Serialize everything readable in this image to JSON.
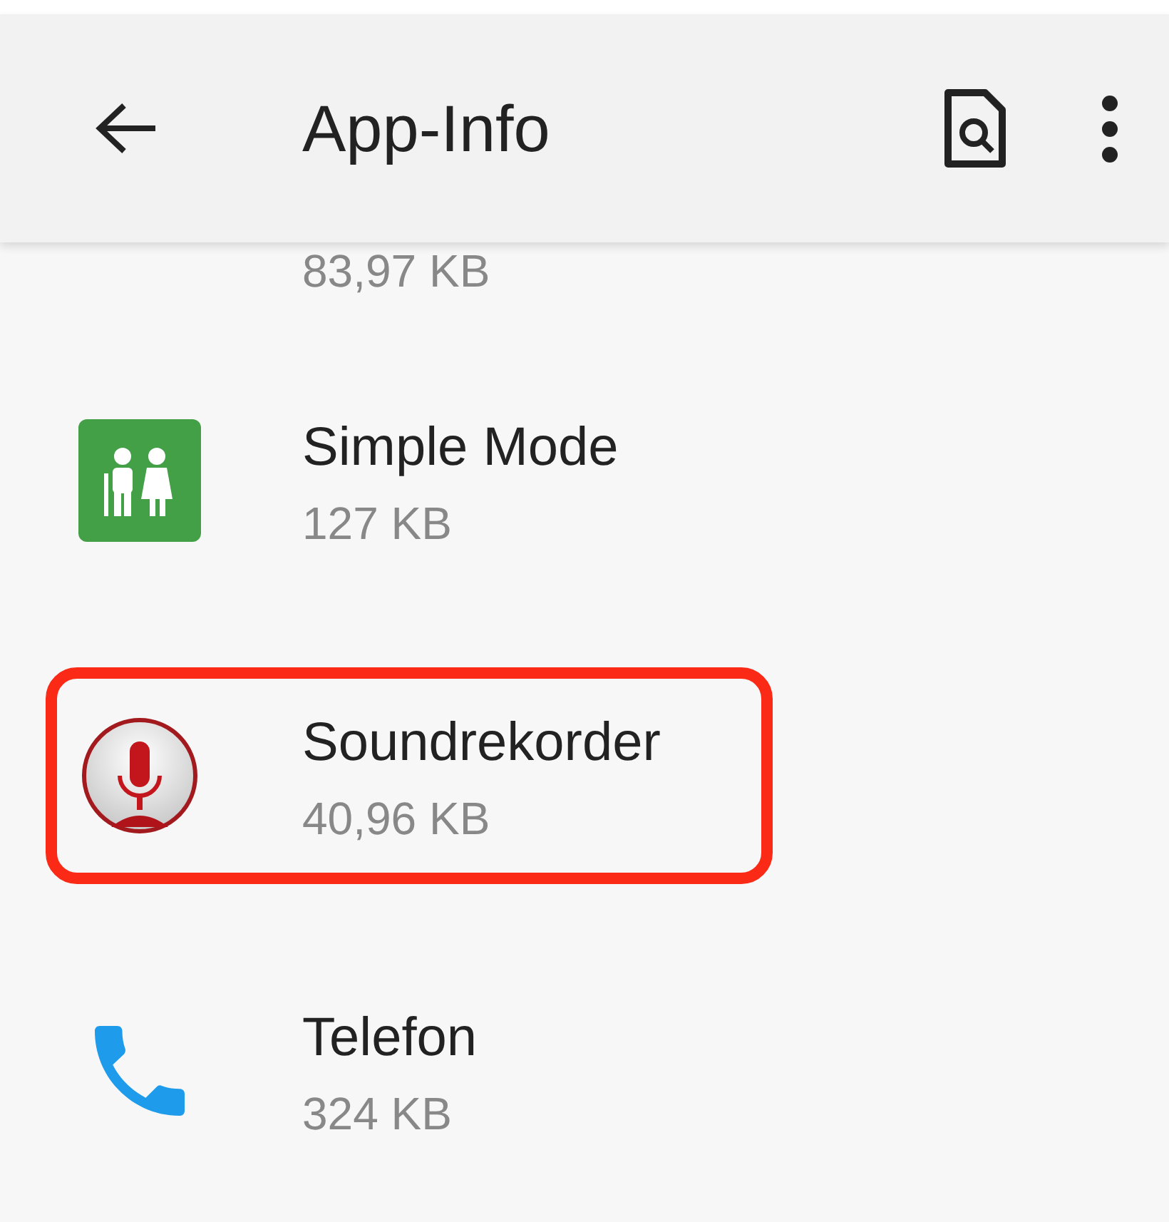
{
  "app_bar": {
    "title": "App-Info"
  },
  "apps": [
    {
      "kind": "partial",
      "size": "83,97 KB",
      "highlighted": false
    },
    {
      "kind": "simple_mode",
      "name": "Simple Mode",
      "size": "127 KB",
      "highlighted": false
    },
    {
      "kind": "recorder",
      "name": "Soundrekorder",
      "size": "40,96 KB",
      "highlighted": true
    },
    {
      "kind": "phone",
      "name": "Telefon",
      "size": "324 KB",
      "highlighted": false
    }
  ]
}
